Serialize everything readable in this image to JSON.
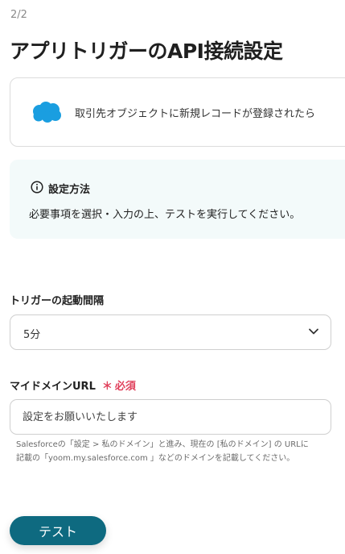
{
  "header": {
    "step": "2/2",
    "title": "アプリトリガーのAPI接続設定"
  },
  "trigger_card": {
    "icon": "salesforce-cloud-icon",
    "text": "取引先オブジェクトに新規レコードが登録されたら"
  },
  "info": {
    "icon": "info-icon",
    "title": "設定方法",
    "text": "必要事項を選択・入力の上、テストを実行してください。"
  },
  "interval": {
    "label": "トリガーの起動間隔",
    "value": "5分",
    "icon": "chevron-down-icon"
  },
  "domain": {
    "label": "マイドメインURL",
    "required_mark": "＊",
    "required_text": "必須",
    "placeholder": "設定をお願いいたします",
    "help_line1": "Salesforceの「設定 > 私のドメイン」と進み、現在の [私のドメイン] の URLに",
    "help_line2": "記載の「yoom.my.salesforce.com 」などのドメインを記載してください。"
  },
  "actions": {
    "test_label": "テスト"
  },
  "colors": {
    "primary": "#0e6a80",
    "salesforce": "#1a9ee0",
    "required": "#e0415c",
    "info_bg": "#f3fafa"
  }
}
